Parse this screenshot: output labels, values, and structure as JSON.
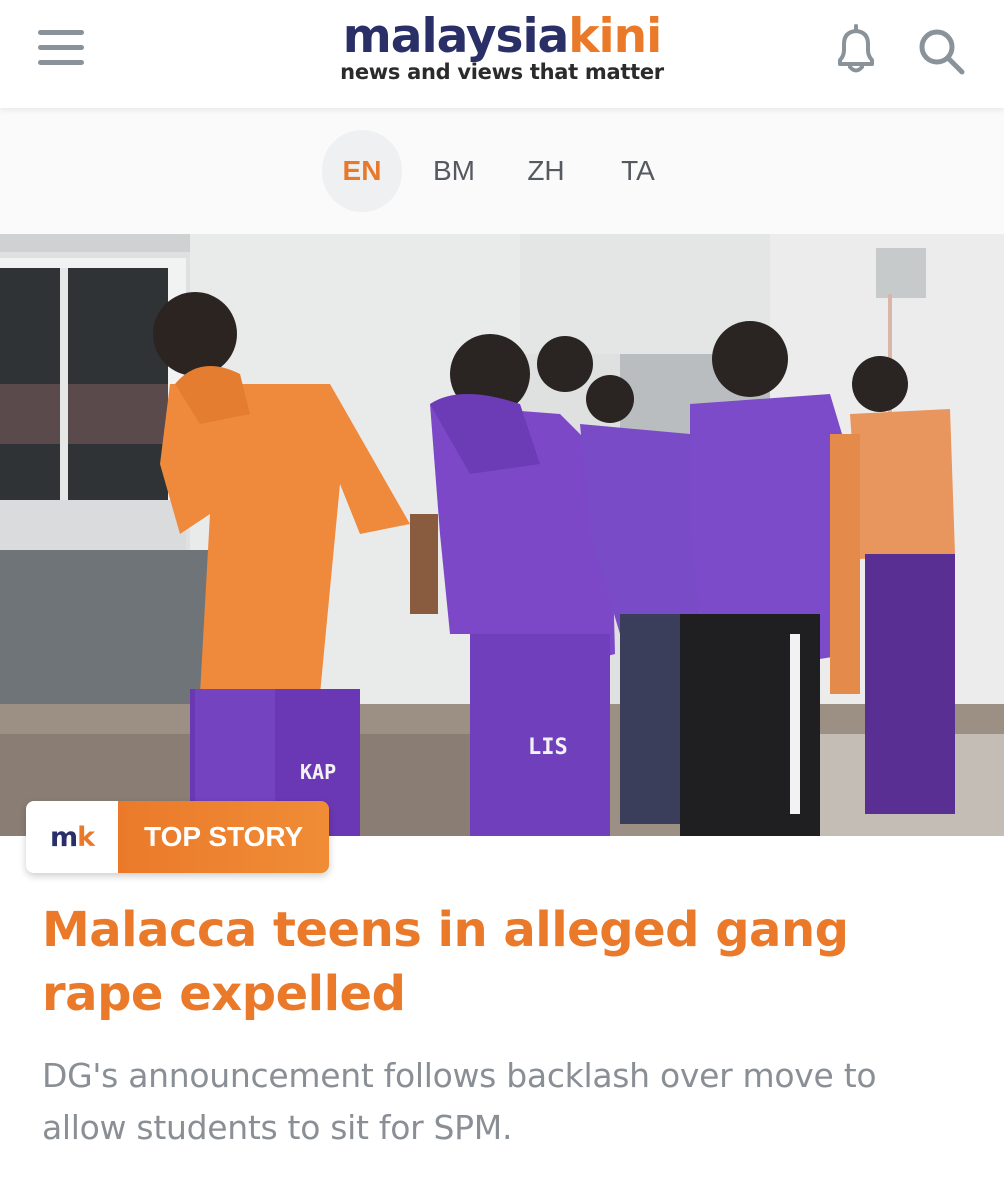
{
  "header": {
    "brand_main": "malaysia",
    "brand_accent": "kini",
    "tagline": "news and views that matter",
    "menu_icon": "hamburger-menu-icon",
    "notification_icon": "bell-icon",
    "search_icon": "search-icon"
  },
  "languages": {
    "tabs": [
      {
        "label": "EN",
        "active": true
      },
      {
        "label": "BM",
        "active": false
      },
      {
        "label": "ZH",
        "active": false
      },
      {
        "label": "TA",
        "active": false
      }
    ]
  },
  "hero": {
    "shirt_text_1": "KAP",
    "shirt_text_2": "LIS"
  },
  "badge": {
    "logo_m": "m",
    "logo_k": "k",
    "label": "TOP STORY"
  },
  "article": {
    "headline": "Malacca teens in alleged gang rape expelled",
    "summary": "DG's announcement follows backlash over move to allow students to sit for SPM."
  },
  "colors": {
    "brand_navy": "#2a2f68",
    "brand_orange": "#ea7a2a",
    "summary_gray": "#8a8f95"
  }
}
